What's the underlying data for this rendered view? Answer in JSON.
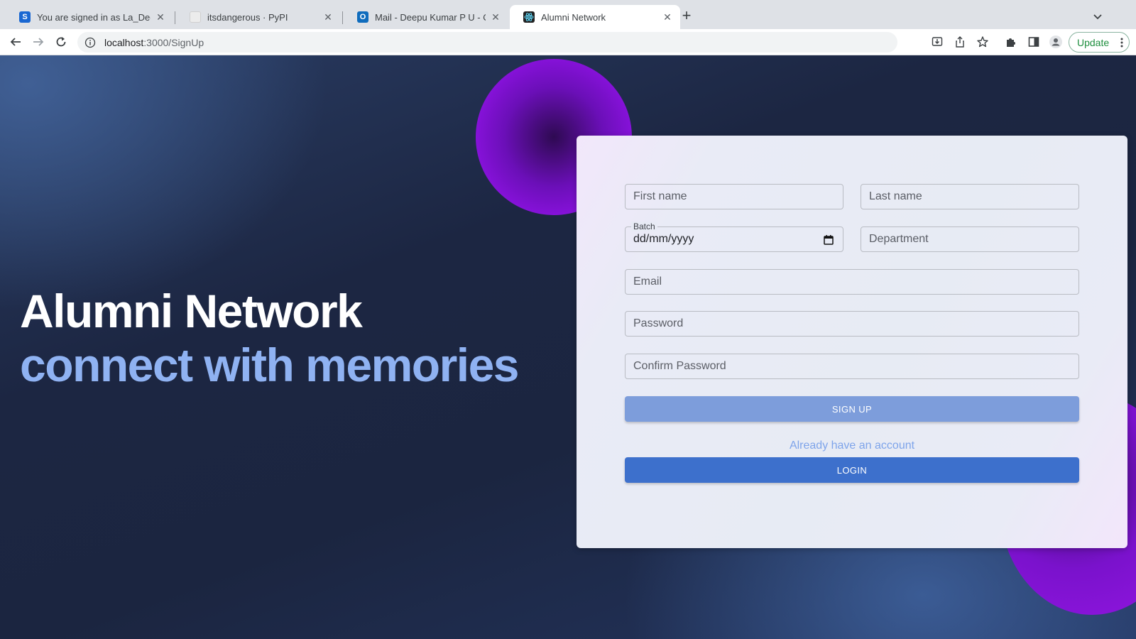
{
  "browser": {
    "tabs": [
      {
        "title": "You are signed in as La_Deepu",
        "favicon_letter": "S",
        "favicon_color": "#1967d2"
      },
      {
        "title": "itsdangerous · PyPI",
        "favicon_color": "#e8e8e8"
      },
      {
        "title": "Mail - Deepu Kumar P U - Outlo",
        "favicon_color": "#0f6cbd"
      },
      {
        "title": "Alumni Network",
        "favicon_color": "#222222"
      }
    ],
    "url_host": "localhost",
    "url_path": ":3000/SignUp",
    "update_label": "Update"
  },
  "hero": {
    "title": "Alumni Network",
    "subtitle": "connect with memories"
  },
  "form": {
    "first_name_placeholder": "First name",
    "last_name_placeholder": "Last name",
    "batch_label": "Batch",
    "batch_value": "dd/mm/yyyy",
    "department_placeholder": "Department",
    "email_placeholder": "Email",
    "password_placeholder": "Password",
    "confirm_password_placeholder": "Confirm Password",
    "signup_label": "SIGN UP",
    "already_text": "Already have an account",
    "login_label": "LOGIN"
  },
  "colors": {
    "signup_button": "#7d9ddb",
    "login_button": "#3d70cc",
    "hero_subtitle": "#8fb2f2",
    "accent_purple": "#8a12de"
  }
}
